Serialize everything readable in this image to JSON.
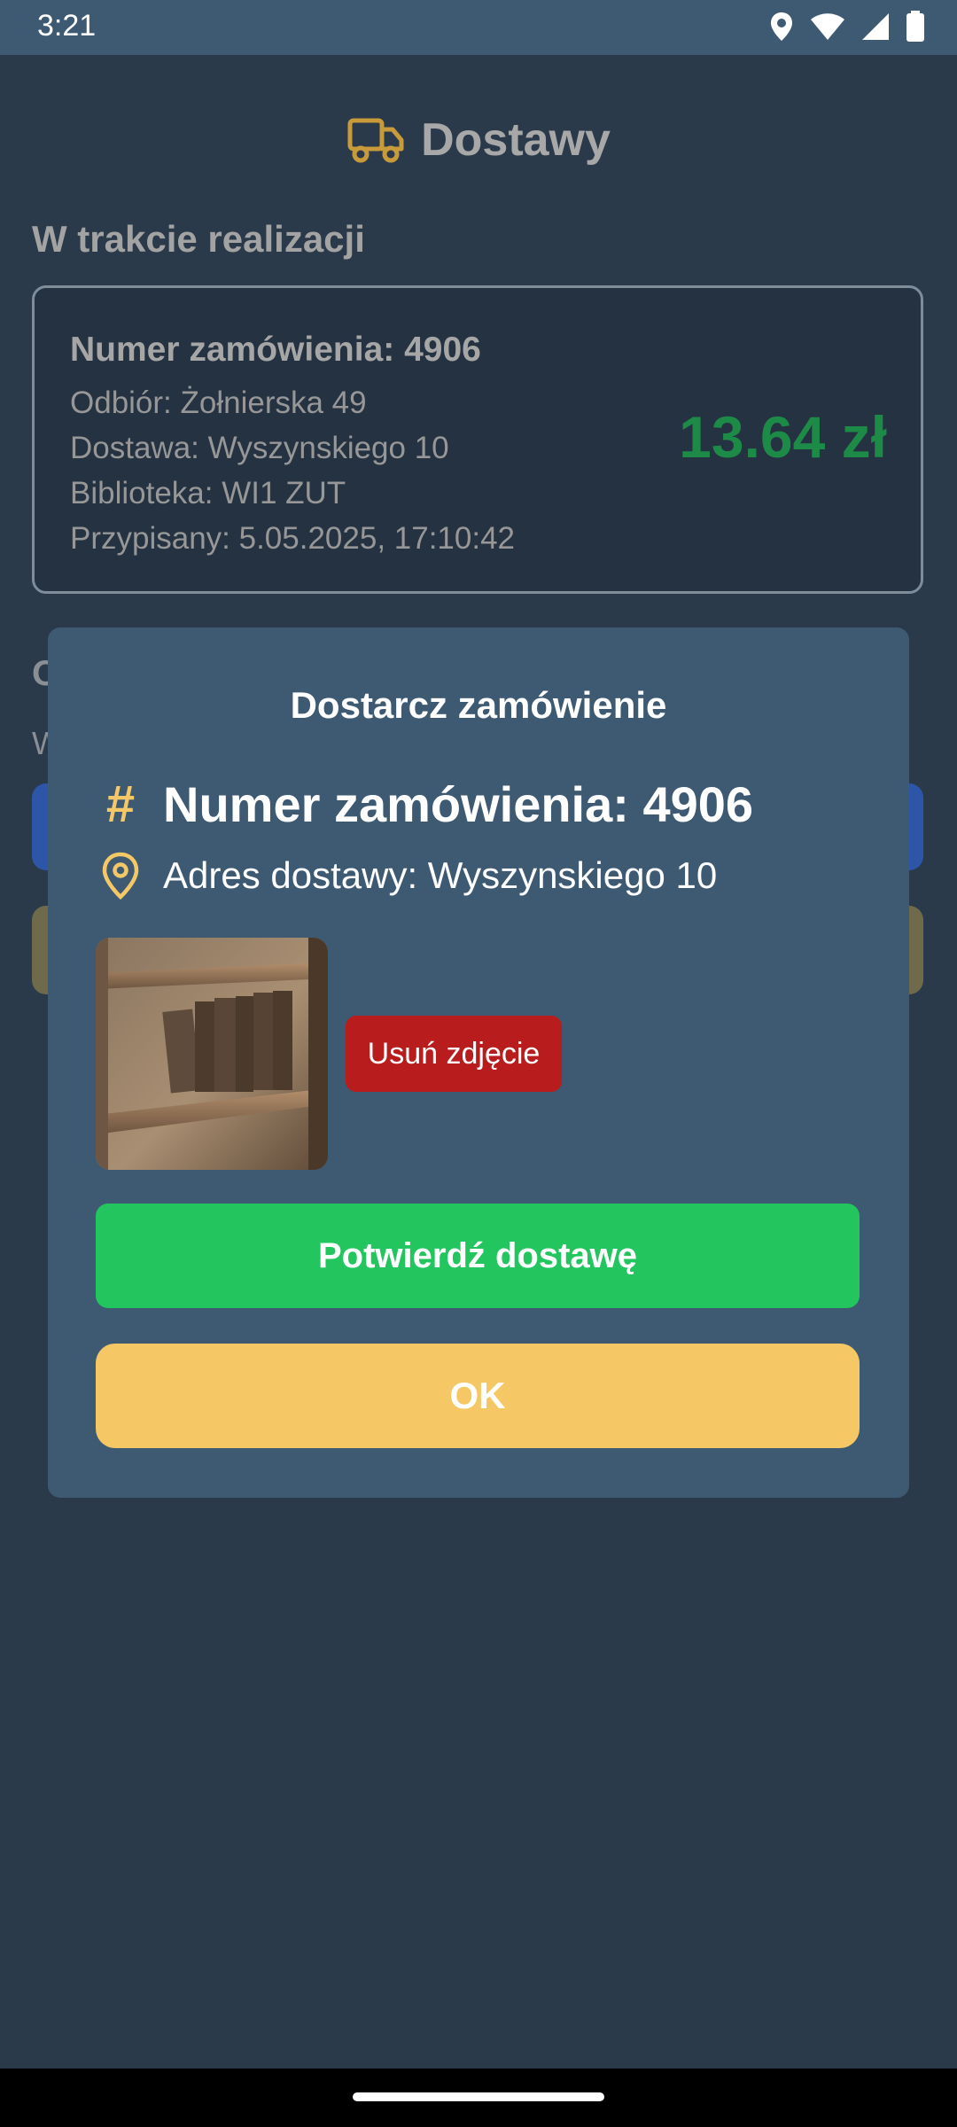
{
  "status_bar": {
    "time": "3:21",
    "icons": [
      "location-icon",
      "wifi-icon",
      "signal-icon",
      "battery-icon"
    ]
  },
  "app": {
    "title": "Dostawy",
    "title_icon": "truck-icon",
    "accent_color": "#c79a3a"
  },
  "in_progress": {
    "section_title": "W trakcie realizacji",
    "card": {
      "order_number": "Numer zamówienia: 4906",
      "pickup": "Odbiór: Żołnierska 49",
      "delivery": "Dostawa: Wyszynskiego 10",
      "library": "Biblioteka: WI1 ZUT",
      "assigned": "Przypisany: 5.05.2025, 17:10:42",
      "price": "13.64 zł"
    }
  },
  "background_partial": {
    "section_letter": "O",
    "line_letter": "W"
  },
  "dialog": {
    "title": "Dostarcz zamówienie",
    "order_icon": "hash-icon",
    "order_number": "Numer zamówienia: 4906",
    "address_icon": "map-pin-icon",
    "address": "Adres dostawy: Wyszynskiego 10",
    "photo_icon": "bookshelf-photo",
    "delete_photo_label": "Usuń zdjęcie",
    "confirm_label": "Potwierdź dostawę",
    "ok_label": "OK"
  },
  "colors": {
    "background": "#2b3a4b",
    "dialog": "#3e5a73",
    "price": "#1d8a47",
    "confirm": "#22c55e",
    "ok": "#f6c865",
    "delete": "#b91c1c"
  }
}
